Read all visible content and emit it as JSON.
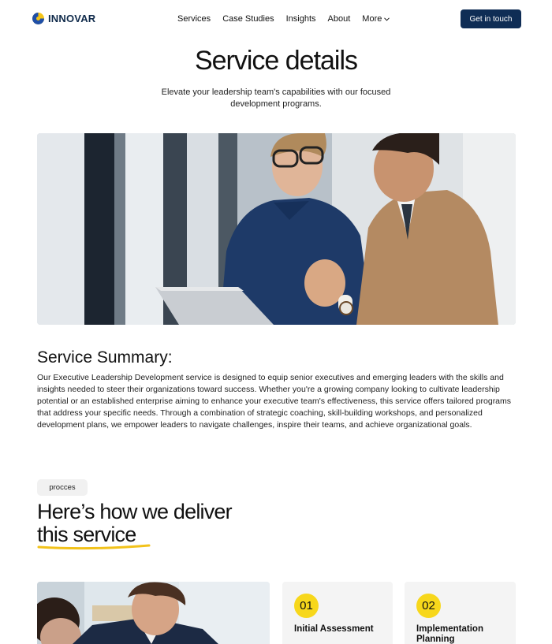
{
  "nav": {
    "brand": "INNOVAR",
    "links": [
      "Services",
      "Case Studies",
      "Insights",
      "About",
      "More"
    ],
    "cta_label": "Get in touch"
  },
  "hero": {
    "title": "Service details",
    "subtitle": "Elevate your leadership team's capabilities with our focused development programs."
  },
  "summary": {
    "title": "Service Summary:",
    "text": "Our Executive Leadership Development service is designed to equip senior executives and emerging leaders with the skills and insights needed to steer their organizations toward success. Whether you're a growing company looking to cultivate leadership potential or an established enterprise aiming to enhance your executive team's effectiveness, this service offers tailored programs that address your specific needs. Through a combination of strategic coaching, skill-building workshops, and personalized development plans, we empower leaders to navigate challenges, inspire their teams, and achieve organizational goals."
  },
  "process": {
    "pill": "procces",
    "heading_line1": "Here’s how we deliver",
    "heading_line2": "this service",
    "steps": [
      {
        "num": "01",
        "label": "Initial Assessment"
      },
      {
        "num": "02",
        "label": "Implementation Planning"
      }
    ]
  },
  "colors": {
    "brand_navy": "#0f2d55",
    "accent_yellow": "#f7d71b",
    "card_bg": "#f4f4f4"
  }
}
